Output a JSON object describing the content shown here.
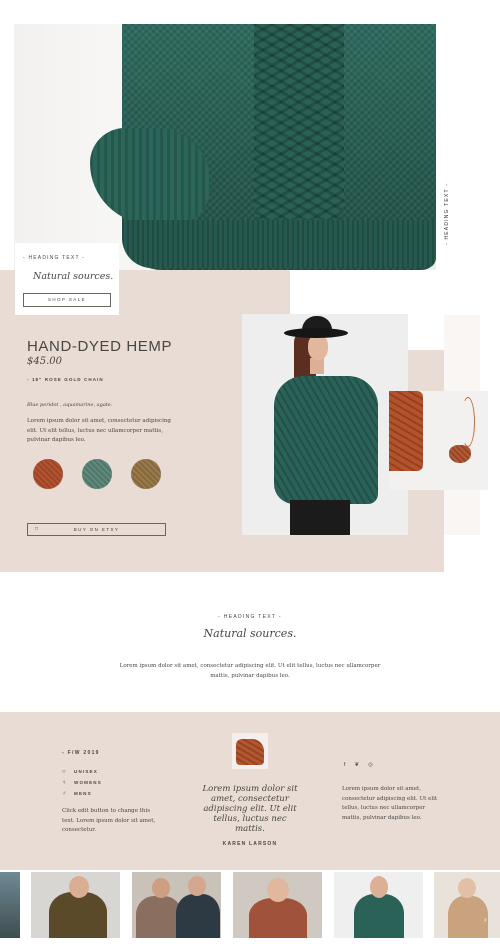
{
  "hero": {
    "vertical_heading": "- HEADING TEXT -",
    "card": {
      "kicker": "- HEADING TEXT -",
      "title": "Natural sources.",
      "button": "SHOP SALE"
    }
  },
  "product": {
    "title": "HAND-DYED HEMP",
    "price": "$45.00",
    "subtitle": "- 18\" ROSE GOLD CHAIN",
    "tagline": "Blue peridot , aquamarine, agate.",
    "description": "Lorem ipsum dolor sit amet, consectetur adipiscing elit. Ut elit tellus, luctus nec ullamcorper mattis, pulvinar dapibus leo.",
    "swatch_colors": [
      "#b5522f",
      "#5f8a7d",
      "#9b7a4a"
    ],
    "buy_button": "BUY ON ETSY",
    "buy_icon": "□"
  },
  "intro": {
    "kicker": "- HEADING TEXT -",
    "title": "Natural sources.",
    "description": "Lorem ipsum dolor sit amet, consectetur adipiscing elit. Ut elit tellus, luctus nec ullamcorper mattis, pulvinar dapibus leo."
  },
  "footer": {
    "season": "- F/W 2019",
    "links": [
      {
        "icon": "○",
        "label": "UNISEX"
      },
      {
        "icon": "♀",
        "label": "WOMENS"
      },
      {
        "icon": "♂",
        "label": "MENS"
      }
    ],
    "note": "Click edit button to change this text. Lorem ipsum dolor sit amet, consectetur.",
    "quote": "Lorem ipsum dolor sit amet, consectetur adipiscing elit. Ut elit tellus, luctus nec mattis.",
    "quote_author": "KAREN LARSON",
    "social": [
      "f",
      "❦",
      "◎"
    ],
    "right_text": "Lorem ipsum dolor sit amet, consectetur adipiscing elit. Ut elit tellus, luctus nec ullamcorper mattis, pulvinar dapibus leo."
  },
  "colors": {
    "accent_bg": "#e8dcd5",
    "text": "#4a4542",
    "knit_green": "#2a6258",
    "rust": "#b5522f"
  }
}
